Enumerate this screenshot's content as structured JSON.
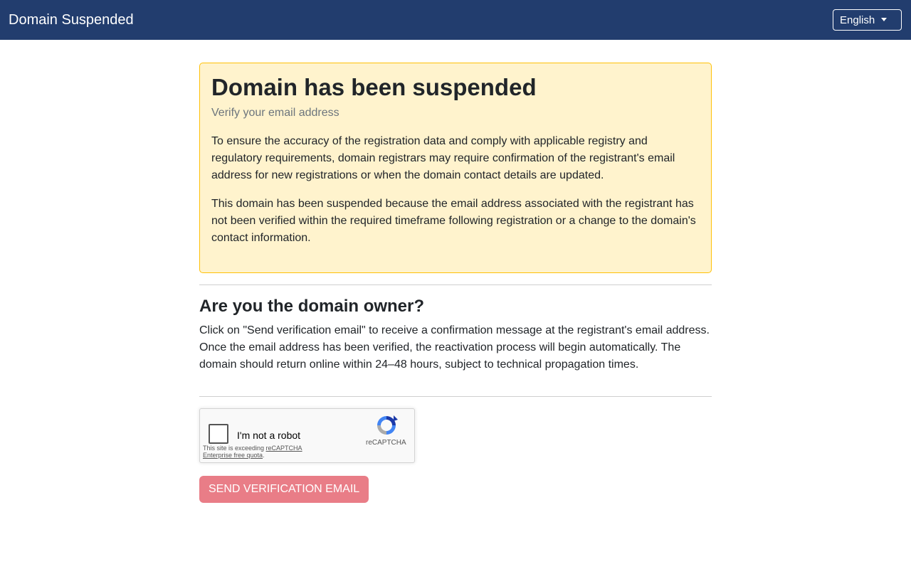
{
  "navbar": {
    "title": "Domain Suspended",
    "language": "English"
  },
  "alert": {
    "title": "Domain has been suspended",
    "subtitle": "Verify your email address",
    "paragraph1": "To ensure the accuracy of the registration data and comply with applicable registry and regulatory requirements, domain registrars may require confirmation of the registrant's email address for new registrations or when the domain contact details are updated.",
    "paragraph2": "This domain has been suspended because the email address associated with the registrant has not been verified within the required timeframe following registration or a change to the domain's contact information."
  },
  "owner": {
    "heading": "Are you the domain owner?",
    "text": "Click on \"Send verification email\" to receive a confirmation message at the registrant's email address. Once the email address has been verified, the reactivation process will begin automatically. The domain should return online within 24–48 hours, subject to technical propagation times."
  },
  "recaptcha": {
    "label": "I'm not a robot",
    "note_prefix": "This site is exceeding ",
    "note_link": "reCAPTCHA Enterprise free quota",
    "note_suffix": ".",
    "brand": "reCAPTCHA",
    "icon": "recaptcha-logo-icon"
  },
  "actions": {
    "send_label": "SEND VERIFICATION EMAIL"
  },
  "colors": {
    "navbar": "#223d6e",
    "alert_bg": "#fff3cd",
    "alert_border": "#ffc107",
    "button": "#e97d87"
  }
}
